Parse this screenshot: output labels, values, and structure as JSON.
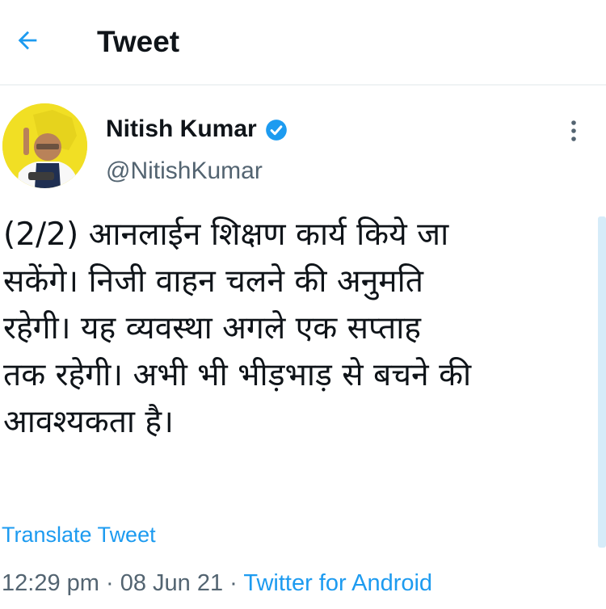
{
  "header": {
    "title": "Tweet",
    "back_icon": "arrow-left-icon"
  },
  "author": {
    "name": "Nitish Kumar",
    "handle": "@NitishKumar",
    "verified_icon": "verified-badge-icon"
  },
  "tweet": {
    "text": "(2/2) आनलाईन शिक्षण कार्य किये जा\nसकेंगे। निजी वाहन चलने की अनुमति\nरहेगी। यह व्यवस्था अगले एक सप्ताह\nतक रहेगी। अभी भी भीड़भाड़ से बचने की\nआवश्यकता है।",
    "translate_label": "Translate Tweet",
    "time": "12:29 pm",
    "separator": " · ",
    "date": "08 Jun 21",
    "source": "Twitter for Android"
  },
  "colors": {
    "accent": "#1d9bf0",
    "text_primary": "#0f1419",
    "text_secondary": "#536471",
    "avatar_background": "#f1df24"
  }
}
